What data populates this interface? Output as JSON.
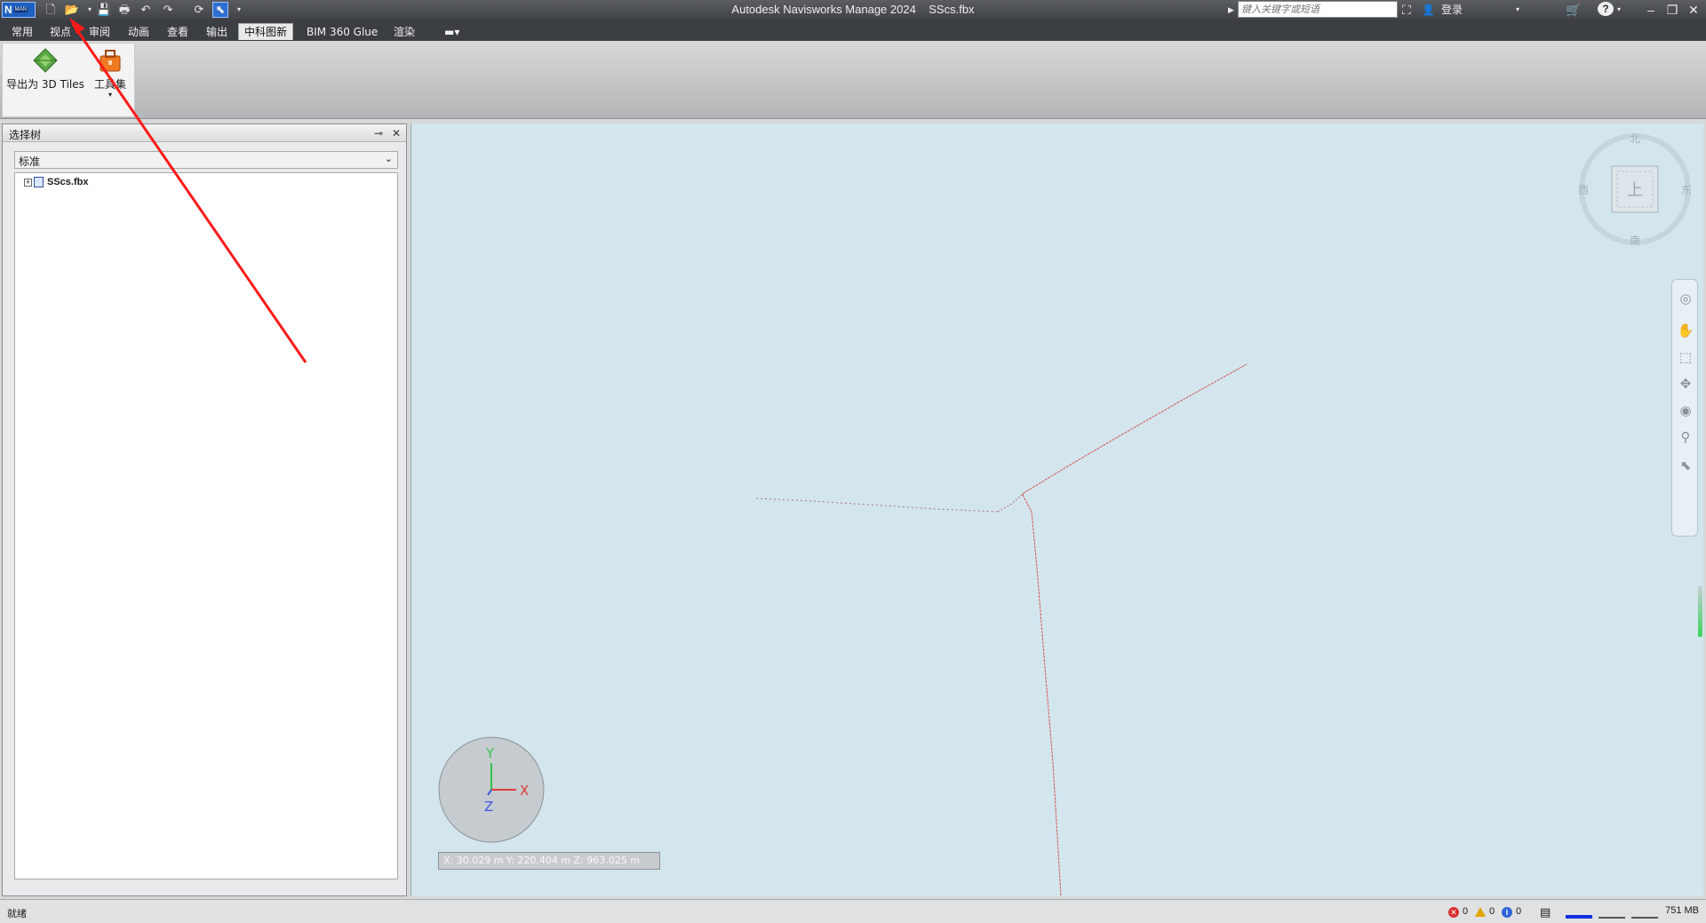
{
  "window": {
    "title": "Autodesk Navisworks Manage 2024",
    "document": "SScs.fbx",
    "logo": {
      "letter": "N",
      "edition": "MAN"
    },
    "search_placeholder": "键入关键字或短语",
    "login_label": "登录"
  },
  "quick_access": [
    {
      "name": "new-file-icon",
      "glyph": "🗋"
    },
    {
      "name": "open-file-icon",
      "glyph": "📂"
    },
    {
      "name": "save-icon",
      "glyph": "💾"
    },
    {
      "name": "print-icon",
      "glyph": "🖶"
    },
    {
      "name": "undo-icon",
      "glyph": "↶"
    },
    {
      "name": "redo-icon",
      "glyph": "↷"
    },
    {
      "name": "refresh-icon",
      "glyph": "⟳"
    },
    {
      "name": "select-cursor-icon",
      "glyph": "⬉"
    }
  ],
  "ribbon": {
    "tabs": [
      "常用",
      "视点",
      "审阅",
      "动画",
      "查看",
      "输出",
      "中科图新",
      "BIM 360 Glue",
      "渲染"
    ],
    "active_tab": "中科图新",
    "buttons": [
      {
        "label": "导出为 3D Tiles",
        "icon": "export-3dtiles-icon"
      },
      {
        "label": "工具集",
        "icon": "toolbox-icon"
      }
    ]
  },
  "selection_tree": {
    "title": "选择树",
    "dropdown_value": "标准",
    "root_item": "SScs.fbx"
  },
  "viewport": {
    "background": "#d3e6ee",
    "line_color": "#d65454",
    "viewcube_labels": {
      "north": "北",
      "south": "南",
      "east": "东",
      "west": "西",
      "face": "上"
    },
    "axis_labels": {
      "x": "X",
      "y": "Y",
      "z": "Z"
    },
    "coordinates": "X: 30.029 m  Y: 220.404 m  Z: 963.025 m"
  },
  "status": {
    "text": "就绪",
    "errors": "0",
    "warnings": "0",
    "info": "0",
    "memory": "751 MB"
  },
  "annotation": {
    "color": "#ff1a1a"
  }
}
